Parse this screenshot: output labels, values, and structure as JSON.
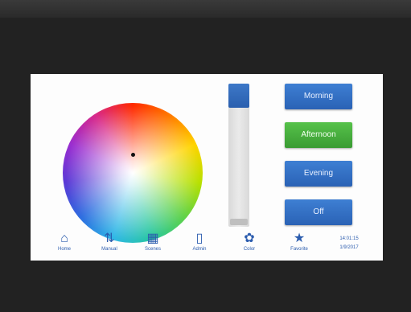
{
  "scenes": [
    {
      "label": "Morning",
      "color": "#3e7fd3"
    },
    {
      "label": "Afternoon",
      "color": "#56c24a"
    },
    {
      "label": "Evening",
      "color": "#3e7fd3"
    },
    {
      "label": "Off",
      "color": "#3e7fd3"
    }
  ],
  "brightness_level": 0.17,
  "nav": [
    {
      "label": "Home",
      "icon": "home-icon"
    },
    {
      "label": "Manual",
      "icon": "manual-sliders-icon"
    },
    {
      "label": "Scenes",
      "icon": "grid-icon"
    },
    {
      "label": "Admin",
      "icon": "admin-device-icon"
    },
    {
      "label": "Color",
      "icon": "palette-icon"
    },
    {
      "label": "Favorite",
      "icon": "star-icon"
    }
  ],
  "clock": {
    "time": "14:01:15",
    "date": "1/9/2017"
  }
}
